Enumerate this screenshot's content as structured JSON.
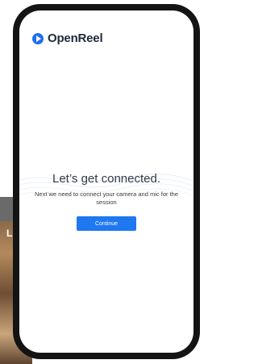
{
  "background": {
    "label": "Li"
  },
  "app": {
    "brand": "OpenReel",
    "logo_icon": "play-circle-icon"
  },
  "main": {
    "headline": "Let’s get connected.",
    "subtext": "Next we need to connect your camera and mic for the session",
    "continue_label": "Continue"
  },
  "colors": {
    "accent": "#1f78f0",
    "frame": "#141414"
  }
}
